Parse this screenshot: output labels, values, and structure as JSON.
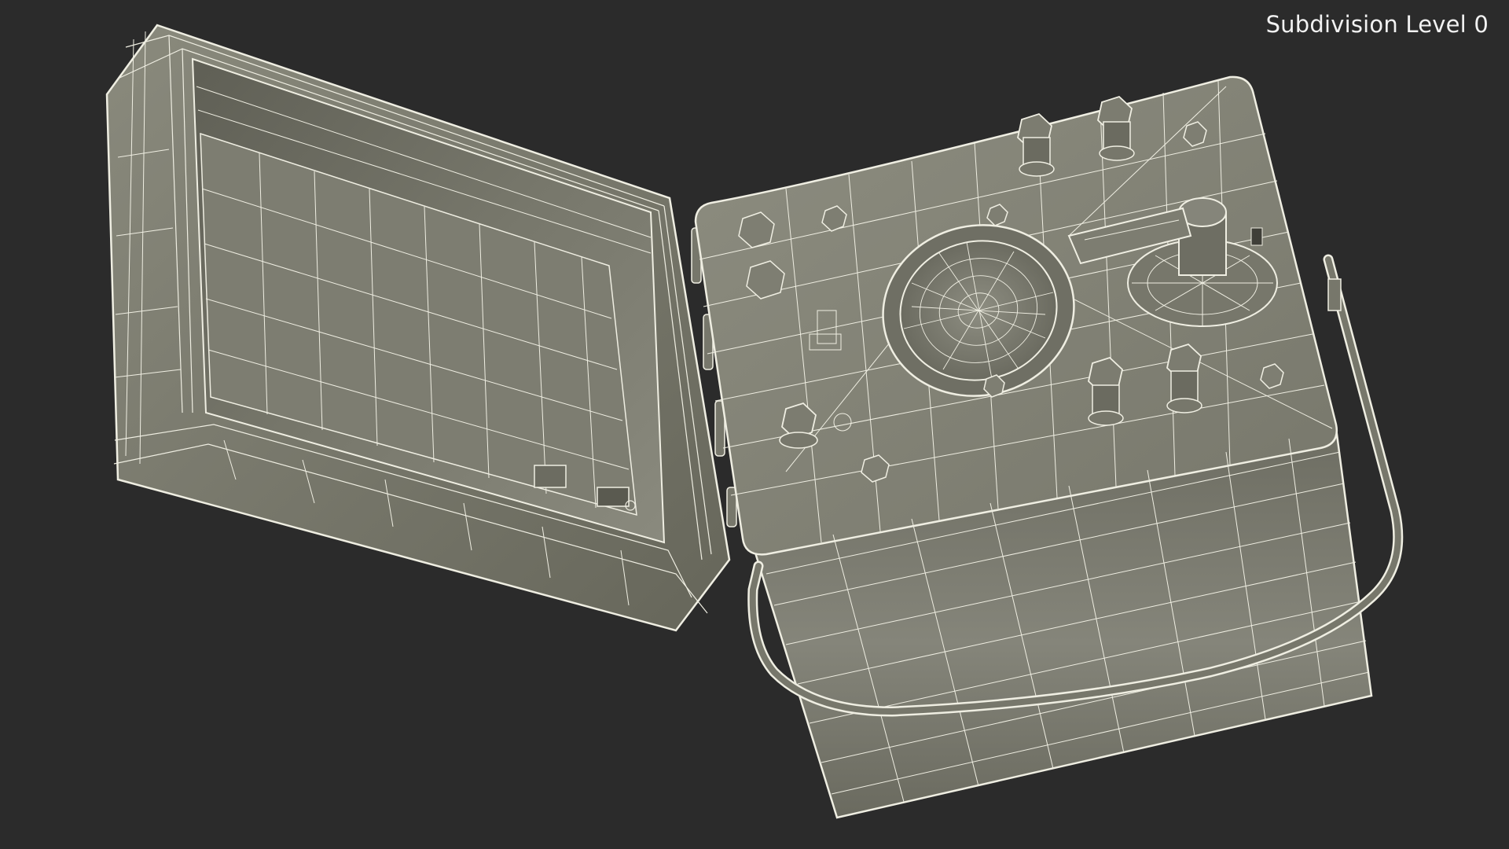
{
  "viewport": {
    "overlay_label": "Subdivision Level 0",
    "background_color": "#2b2b2b",
    "mesh_surface_color": "#7b7b6e",
    "wireframe_color": "#efeee2"
  }
}
